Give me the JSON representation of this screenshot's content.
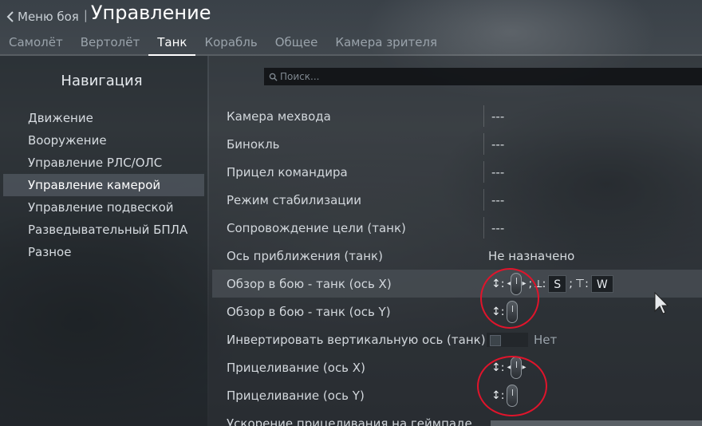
{
  "header": {
    "back_label": "Меню боя",
    "separator": "|",
    "title": "Управление"
  },
  "tabs": [
    {
      "label": "Самолёт",
      "active": false
    },
    {
      "label": "Вертолёт",
      "active": false
    },
    {
      "label": "Танк",
      "active": true
    },
    {
      "label": "Корабль",
      "active": false
    },
    {
      "label": "Общее",
      "active": false
    },
    {
      "label": "Камера зрителя",
      "active": false
    }
  ],
  "nav": {
    "title": "Навигация",
    "items": [
      {
        "label": "Движение",
        "active": false
      },
      {
        "label": "Вооружение",
        "active": false
      },
      {
        "label": "Управление РЛС/ОЛС",
        "active": false
      },
      {
        "label": "Управление камерой",
        "active": true
      },
      {
        "label": "Управление подвеской",
        "active": false
      },
      {
        "label": "Разведывательный БПЛА",
        "active": false
      },
      {
        "label": "Разное",
        "active": false
      }
    ]
  },
  "search": {
    "placeholder": "Поиск..."
  },
  "rows": [
    {
      "label": "Камера мехвода",
      "value": "---"
    },
    {
      "label": "Бинокль",
      "value": "---"
    },
    {
      "label": "Прицел командира",
      "value": "---"
    },
    {
      "label": "Режим стабилизации",
      "value": "---"
    },
    {
      "label": "Сопровождение цели (танк)",
      "value": "---"
    },
    {
      "label": "Ось приближения (танк)",
      "value": "Не назначено"
    },
    {
      "label": "Обзор в бою - танк (ось X)",
      "key1": "S",
      "key2": "W"
    },
    {
      "label": "Обзор в бою - танк (ось Y)"
    },
    {
      "label": "Инвертировать вертикальную ось (танк)",
      "toggle_label": "Нет"
    },
    {
      "label": "Прицеливание (ось X)"
    },
    {
      "label": "Прицеливание (ось Y)"
    },
    {
      "label": "Ускорение прицеливания на геймпаде"
    }
  ],
  "glyphs": {
    "axis": "↕:",
    "axis_minus": "⟂:",
    "axis_plus": "⊤:",
    "semicolon": ";"
  },
  "colors": {
    "annotation": "#e0142b",
    "highlight_row": "#464c52"
  }
}
